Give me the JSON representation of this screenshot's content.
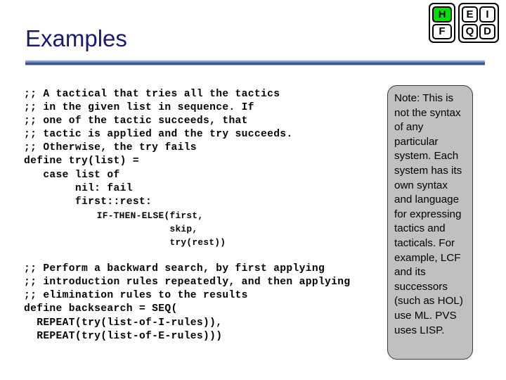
{
  "slide": {
    "title": "Examples",
    "title_color": "#1a1a70",
    "background_color": "#ffffff"
  },
  "logo": {
    "name": "efiqd-logo",
    "left_block": {
      "cells": [
        {
          "label": "H",
          "highlight": true,
          "color": "#00e000"
        },
        {
          "label": "F",
          "highlight": false,
          "color": "#ffffff"
        }
      ]
    },
    "right_block": {
      "cells": [
        {
          "label": "E",
          "highlight": false
        },
        {
          "label": "I",
          "highlight": false
        },
        {
          "label": "Q",
          "highlight": false
        },
        {
          "label": "D",
          "highlight": false
        }
      ]
    }
  },
  "code": {
    "lines": [
      {
        "text": ";; A tactical that tries all the tactics",
        "size": "normal"
      },
      {
        "text": ";; in the given list in sequence. If",
        "size": "normal"
      },
      {
        "text": ";; one of the tactic succeeds, that",
        "size": "normal"
      },
      {
        "text": ";; tactic is applied and the try succeeds.",
        "size": "normal"
      },
      {
        "text": ";; Otherwise, the try fails",
        "size": "normal"
      },
      {
        "text": "define try(list) =",
        "size": "normal"
      },
      {
        "text": "   case list of",
        "size": "normal"
      },
      {
        "text": "        nil: fail",
        "size": "normal"
      },
      {
        "text": "        first::rest:",
        "size": "normal"
      },
      {
        "text": "             IF-THEN-ELSE(first,",
        "size": "small"
      },
      {
        "text": "                          skip,",
        "size": "small"
      },
      {
        "text": "                          try(rest))",
        "size": "small"
      },
      {
        "text": "",
        "size": "gap"
      },
      {
        "text": ";; Perform a backward search, by first applying",
        "size": "normal"
      },
      {
        "text": ";; introduction rules repeatedly, and then applying",
        "size": "normal"
      },
      {
        "text": ";; elimination rules to the results",
        "size": "normal"
      },
      {
        "text": "define backsearch = SEQ(",
        "size": "normal"
      },
      {
        "text": "  REPEAT(try(list-of-I-rules)),",
        "size": "normal"
      },
      {
        "text": "  REPEAT(try(list-of-E-rules)))",
        "size": "normal"
      }
    ]
  },
  "note": {
    "text": "Note: This is not the syntax of any particular system. Each system has its own syntax and language for expressing tactics and tacticals. For example, LCF and its successors (such as HOL) use ML. PVS uses LISP.",
    "background_color": "#c0c0c0",
    "border_color": "#3d3d3d"
  }
}
